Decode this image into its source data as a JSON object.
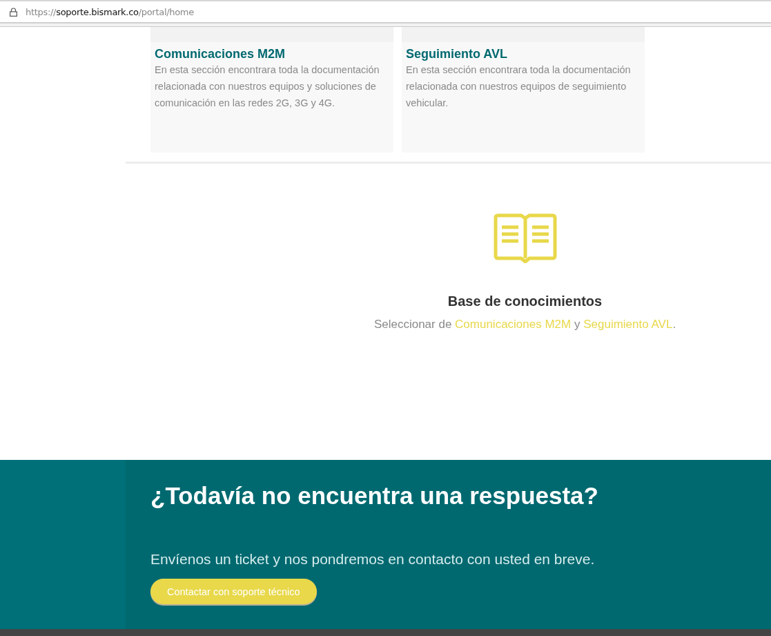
{
  "address_bar": {
    "scheme": "https://",
    "host": "soporte.bismark.co",
    "path": "/portal/home"
  },
  "categories": [
    {
      "title": "Comunicaciones M2M",
      "description": "En esta sección encontrara toda la documentación relacionada con nuestros equipos y soluciones de comunicación en las redes 2G, 3G y 4G."
    },
    {
      "title": "Seguimiento AVL",
      "description": "En esta sección encontrara toda la documentación relacionada con nuestros equipos de seguimiento vehicular."
    }
  ],
  "knowledge_base": {
    "title": "Base de conocimientos",
    "lead": "Seleccionar de ",
    "link_1": "Comunicaciones M2M",
    "joiner": " y ",
    "link_2": "Seguimiento AVL",
    "end": "."
  },
  "contact": {
    "title": "¿Todavía no encuentra una respuesta?",
    "text": "Envíenos un ticket y nos pondremos en contacto con usted en breve.",
    "button": "Contactar con soporte técnico"
  }
}
